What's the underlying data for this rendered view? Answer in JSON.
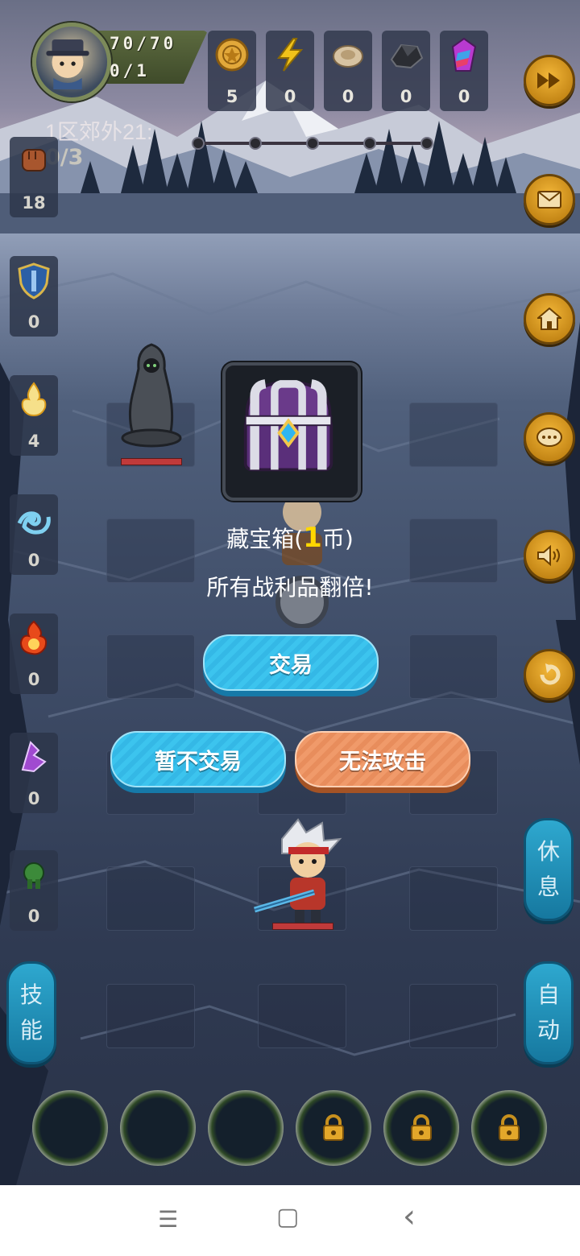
{
  "player": {
    "hp": "70/70",
    "mp": "0/1"
  },
  "resources": [
    {
      "icon": "gold-coin-icon",
      "value": "5"
    },
    {
      "icon": "lightning-icon",
      "value": "0"
    },
    {
      "icon": "shell-icon",
      "value": "0"
    },
    {
      "icon": "ore-icon",
      "value": "0"
    },
    {
      "icon": "crystal-icon",
      "value": "0"
    }
  ],
  "stage": {
    "label": "1区郊外21:",
    "progress": "0/3",
    "nodes": 5
  },
  "sidebar": [
    {
      "icon": "fist-icon",
      "value": "18"
    },
    {
      "icon": "shield-icon",
      "value": "0"
    },
    {
      "icon": "holy-flame-icon",
      "value": "4"
    },
    {
      "icon": "water-wave-icon",
      "value": "0"
    },
    {
      "icon": "fire-icon",
      "value": "0"
    },
    {
      "icon": "purple-rune-icon",
      "value": "0"
    },
    {
      "icon": "green-beast-icon",
      "value": "0"
    }
  ],
  "right_buttons": [
    {
      "icon": "fast-forward-icon"
    },
    {
      "icon": "mail-icon"
    },
    {
      "icon": "home-icon"
    },
    {
      "icon": "chat-icon"
    },
    {
      "icon": "sound-icon"
    },
    {
      "icon": "return-icon"
    }
  ],
  "dialog": {
    "item_name": "藏宝箱(",
    "price": "1",
    "price_suffix": "币)",
    "description": "所有战利品翻倍!",
    "trade_button": "交易",
    "decline_button": "暂不交易",
    "attack_button": "无法攻击"
  },
  "side_buttons": {
    "rest": [
      "休",
      "息"
    ],
    "skill": [
      "技",
      "能"
    ],
    "auto": [
      "自",
      "动"
    ]
  },
  "skill_slots": [
    "empty",
    "empty",
    "empty",
    "locked",
    "locked",
    "locked"
  ],
  "navbar": {
    "menu_icon": "☰",
    "home_icon": "▢",
    "back_icon": "‹"
  },
  "colors": {
    "gold": "#ffd700",
    "trade_blue": "#3cc4ee",
    "attack_orange": "#f09a6a"
  }
}
